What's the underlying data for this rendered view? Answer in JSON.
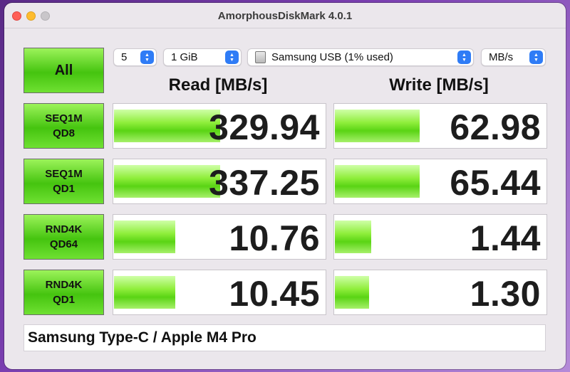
{
  "window": {
    "title": "AmorphousDiskMark 4.0.1"
  },
  "controls": {
    "all_label": "All",
    "count": "5",
    "size": "1 GiB",
    "drive": "Samsung USB (1% used)",
    "unit": "MB/s"
  },
  "headers": {
    "read": "Read [MB/s]",
    "write": "Write [MB/s]"
  },
  "tests": [
    {
      "line1": "SEQ1M",
      "line2": "QD8",
      "read": "329.94",
      "write": "62.98",
      "read_fill": 0.5,
      "write_fill": 0.4
    },
    {
      "line1": "SEQ1M",
      "line2": "QD1",
      "read": "337.25",
      "write": "65.44",
      "read_fill": 0.5,
      "write_fill": 0.4
    },
    {
      "line1": "RND4K",
      "line2": "QD64",
      "read": "10.76",
      "write": "1.44",
      "read_fill": 0.29,
      "write_fill": 0.17
    },
    {
      "line1": "RND4K",
      "line2": "QD1",
      "read": "10.45",
      "write": "1.30",
      "read_fill": 0.29,
      "write_fill": 0.16
    }
  ],
  "comment": "Samsung Type-C / Apple M4 Pro",
  "colors": {
    "bar_green": "#5ad414",
    "button_green": "#45c40f",
    "chevron_blue": "#2f7cf6"
  }
}
